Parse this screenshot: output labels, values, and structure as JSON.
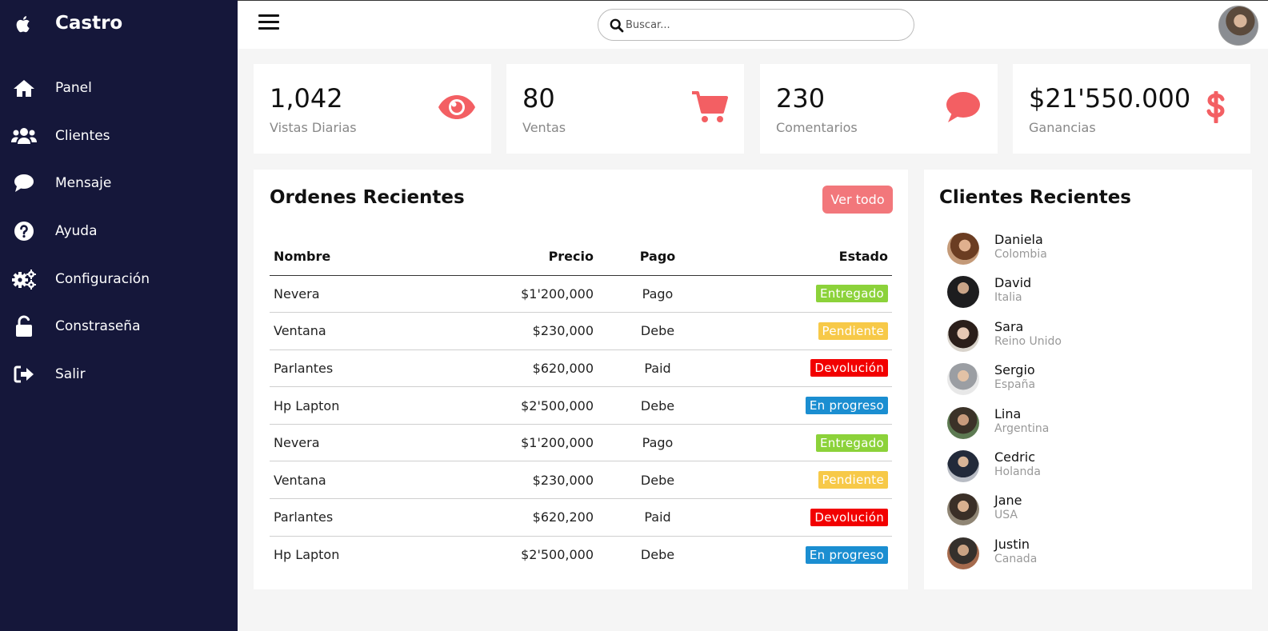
{
  "brand": {
    "name": "Castro",
    "icon": "apple-icon"
  },
  "sidebar": {
    "items": [
      {
        "label": "Panel",
        "icon": "home-icon"
      },
      {
        "label": "Clientes",
        "icon": "users-icon"
      },
      {
        "label": "Mensaje",
        "icon": "chat-icon"
      },
      {
        "label": "Ayuda",
        "icon": "help-icon"
      },
      {
        "label": "Configuración",
        "icon": "gears-icon"
      },
      {
        "label": "Constraseña",
        "icon": "unlock-icon"
      },
      {
        "label": "Salir",
        "icon": "logout-icon"
      }
    ]
  },
  "topbar": {
    "search_placeholder": "Buscar...",
    "search_value": ""
  },
  "cards": [
    {
      "number": "1,042",
      "caption": "Vistas Diarias",
      "icon": "eye-icon"
    },
    {
      "number": "80",
      "caption": "Ventas",
      "icon": "cart-icon"
    },
    {
      "number": "230",
      "caption": "Comentarios",
      "icon": "comment-icon"
    },
    {
      "number": "$21'550.000",
      "caption": "Ganancias",
      "icon": "dollar-icon"
    }
  ],
  "orders": {
    "title": "Ordenes Recientes",
    "view_all": "Ver todo",
    "columns": [
      "Nombre",
      "Precio",
      "Pago",
      "Estado"
    ],
    "rows": [
      {
        "name": "Nevera",
        "price": "$1'200,000",
        "pay": "Pago",
        "status": "Entregado",
        "status_color": "#8cd23a"
      },
      {
        "name": "Ventana",
        "price": "$230,000",
        "pay": "Debe",
        "status": "Pendiente",
        "status_color": "#f7c948"
      },
      {
        "name": "Parlantes",
        "price": "$620,000",
        "pay": "Paid",
        "status": "Devolución",
        "status_color": "#f20000"
      },
      {
        "name": "Hp Lapton",
        "price": "$2'500,000",
        "pay": "Debe",
        "status": "En progreso",
        "status_color": "#1b8ed1"
      },
      {
        "name": "Nevera",
        "price": "$1'200,000",
        "pay": "Pago",
        "status": "Entregado",
        "status_color": "#8cd23a"
      },
      {
        "name": "Ventana",
        "price": "$230,000",
        "pay": "Debe",
        "status": "Pendiente",
        "status_color": "#f7c948"
      },
      {
        "name": "Parlantes",
        "price": "$620,200",
        "pay": "Paid",
        "status": "Devolución",
        "status_color": "#f20000"
      },
      {
        "name": "Hp Lapton",
        "price": "$2'500,000",
        "pay": "Debe",
        "status": "En progreso",
        "status_color": "#1b8ed1"
      }
    ]
  },
  "clients": {
    "title": "Clientes Recientes",
    "items": [
      {
        "name": "Daniela",
        "country": "Colombia"
      },
      {
        "name": "David",
        "country": "Italia"
      },
      {
        "name": "Sara",
        "country": "Reino Unido"
      },
      {
        "name": "Sergio",
        "country": "España"
      },
      {
        "name": "Lina",
        "country": "Argentina"
      },
      {
        "name": "Cedric",
        "country": "Holanda"
      },
      {
        "name": "Jane",
        "country": "USA"
      },
      {
        "name": "Justin",
        "country": "Canada"
      }
    ]
  },
  "colors": {
    "sidebar": "#15173a",
    "accent": "#f2777b",
    "card_icon": "#f35f63"
  }
}
